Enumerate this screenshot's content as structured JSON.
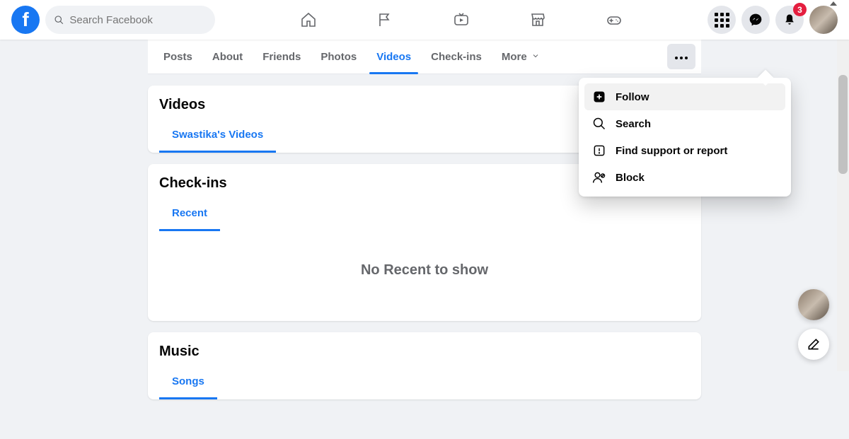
{
  "search": {
    "placeholder": "Search Facebook"
  },
  "notifications": {
    "count": "3"
  },
  "tabs": {
    "posts": "Posts",
    "about": "About",
    "friends": "Friends",
    "photos": "Photos",
    "videos": "Videos",
    "checkins": "Check-ins",
    "more": "More"
  },
  "dropdown": {
    "follow": "Follow",
    "search": "Search",
    "report": "Find support or report",
    "block": "Block"
  },
  "cards": {
    "videos": {
      "title": "Videos",
      "subtab": "Swastika's Videos"
    },
    "checkins": {
      "title": "Check-ins",
      "subtab": "Recent",
      "empty": "No Recent to show"
    },
    "music": {
      "title": "Music",
      "subtab": "Songs"
    }
  }
}
